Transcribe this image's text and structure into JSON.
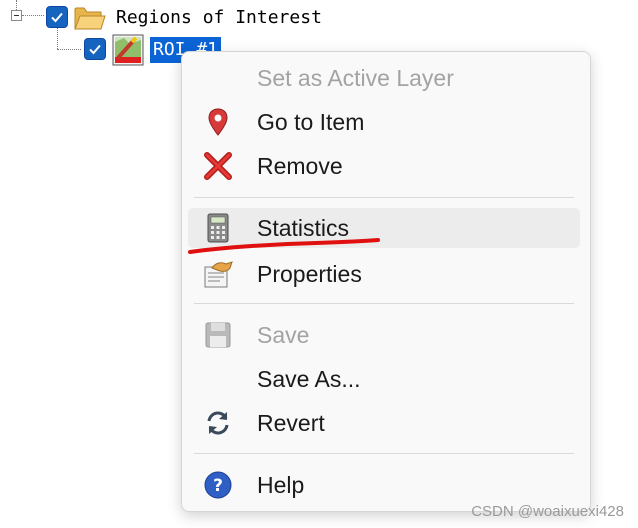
{
  "tree": {
    "root_label": "Regions of Interest",
    "child_label": "ROI #1",
    "root_checked": true,
    "child_checked": true,
    "selection_color": "#0a64d6"
  },
  "context_menu": {
    "items": [
      {
        "label": "Set as Active Layer",
        "icon": "",
        "enabled": false
      },
      {
        "label": "Go to Item",
        "icon": "location-pin-icon",
        "enabled": true
      },
      {
        "label": "Remove",
        "icon": "red-x-icon",
        "enabled": true
      },
      {
        "label": "Statistics",
        "icon": "calculator-icon",
        "enabled": true,
        "hovered": true
      },
      {
        "label": "Properties",
        "icon": "properties-icon",
        "enabled": true
      },
      {
        "label": "Save",
        "icon": "floppy-disk-icon",
        "enabled": false
      },
      {
        "label": "Save As...",
        "icon": "",
        "enabled": true
      },
      {
        "label": "Revert",
        "icon": "refresh-icon",
        "enabled": true
      },
      {
        "label": "Help",
        "icon": "help-icon",
        "enabled": true
      }
    ]
  },
  "annotation_color": "#e01010",
  "watermark": "CSDN @woaixuexi428"
}
